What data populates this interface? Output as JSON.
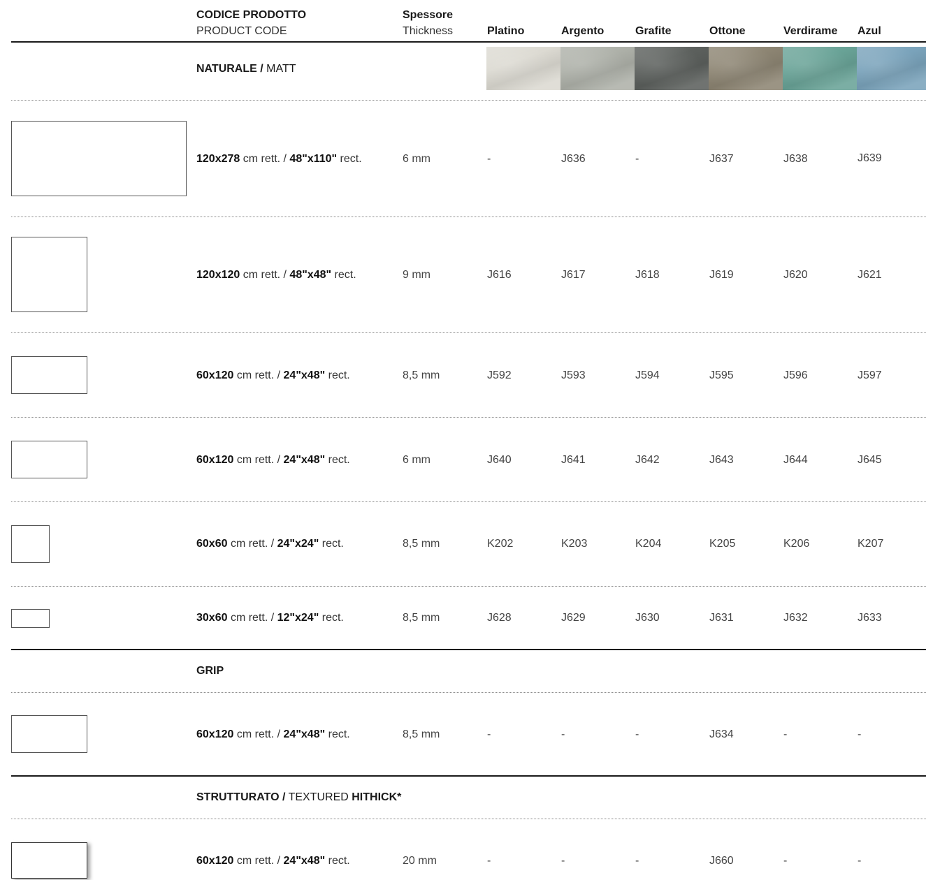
{
  "header": {
    "code_it": "CODICE PRODOTTO",
    "code_en": "PRODUCT CODE",
    "thickness_it": "Spessore",
    "thickness_en": "Thickness",
    "colors": [
      "Platino",
      "Argento",
      "Grafite",
      "Ottone",
      "Verdirame",
      "Azul"
    ]
  },
  "swatch_colors": [
    "#dcdad2",
    "#aeb1a9",
    "#5c605d",
    "#8d8573",
    "#69a397",
    "#7aa3bb"
  ],
  "sections": {
    "naturale": {
      "bold": "NATURALE /",
      "light": " MATT"
    },
    "grip": {
      "bold": "GRIP"
    },
    "strutturato": {
      "bold1": "STRUTTURATO /",
      "light": " TEXTURED ",
      "bold2": "HITHICK*"
    }
  },
  "rows": [
    {
      "cm": "120x278",
      "cm_unit": " cm rett. / ",
      "inch": "48\"x110\"",
      "inch_unit": " rect.",
      "thickness": "6 mm",
      "codes": [
        "-",
        "J636",
        "-",
        "J637",
        "J638",
        "J639"
      ]
    },
    {
      "cm": "120x120",
      "cm_unit": " cm rett. / ",
      "inch": "48\"x48\"",
      "inch_unit": " rect.",
      "thickness": "9 mm",
      "codes": [
        "J616",
        "J617",
        "J618",
        "J619",
        "J620",
        "J621"
      ]
    },
    {
      "cm": "60x120",
      "cm_unit": " cm rett. / ",
      "inch": "24\"x48\"",
      "inch_unit": " rect.",
      "thickness": "8,5 mm",
      "codes": [
        "J592",
        "J593",
        "J594",
        "J595",
        "J596",
        "J597"
      ]
    },
    {
      "cm": "60x120",
      "cm_unit": " cm rett. / ",
      "inch": "24\"x48\"",
      "inch_unit": " rect.",
      "thickness": "6 mm",
      "codes": [
        "J640",
        "J641",
        "J642",
        "J643",
        "J644",
        "J645"
      ]
    },
    {
      "cm": "60x60",
      "cm_unit": " cm rett. / ",
      "inch": "24\"x24\"",
      "inch_unit": " rect.",
      "thickness": "8,5 mm",
      "codes": [
        "K202",
        "K203",
        "K204",
        "K205",
        "K206",
        "K207"
      ]
    },
    {
      "cm": "30x60",
      "cm_unit": " cm rett. / ",
      "inch": "12\"x24\"",
      "inch_unit": " rect.",
      "thickness": "8,5 mm",
      "codes": [
        "J628",
        "J629",
        "J630",
        "J631",
        "J632",
        "J633"
      ]
    },
    {
      "cm": "60x120",
      "cm_unit": " cm rett. / ",
      "inch": "24\"x48\"",
      "inch_unit": " rect.",
      "thickness": "8,5 mm",
      "codes": [
        "-",
        "-",
        "-",
        "J634",
        "-",
        "-"
      ]
    },
    {
      "cm": "60x120",
      "cm_unit": " cm rett. / ",
      "inch": "24\"x48\"",
      "inch_unit": " rect.",
      "thickness": "20 mm",
      "codes": [
        "-",
        "-",
        "-",
        "J660",
        "-",
        "-"
      ]
    }
  ]
}
